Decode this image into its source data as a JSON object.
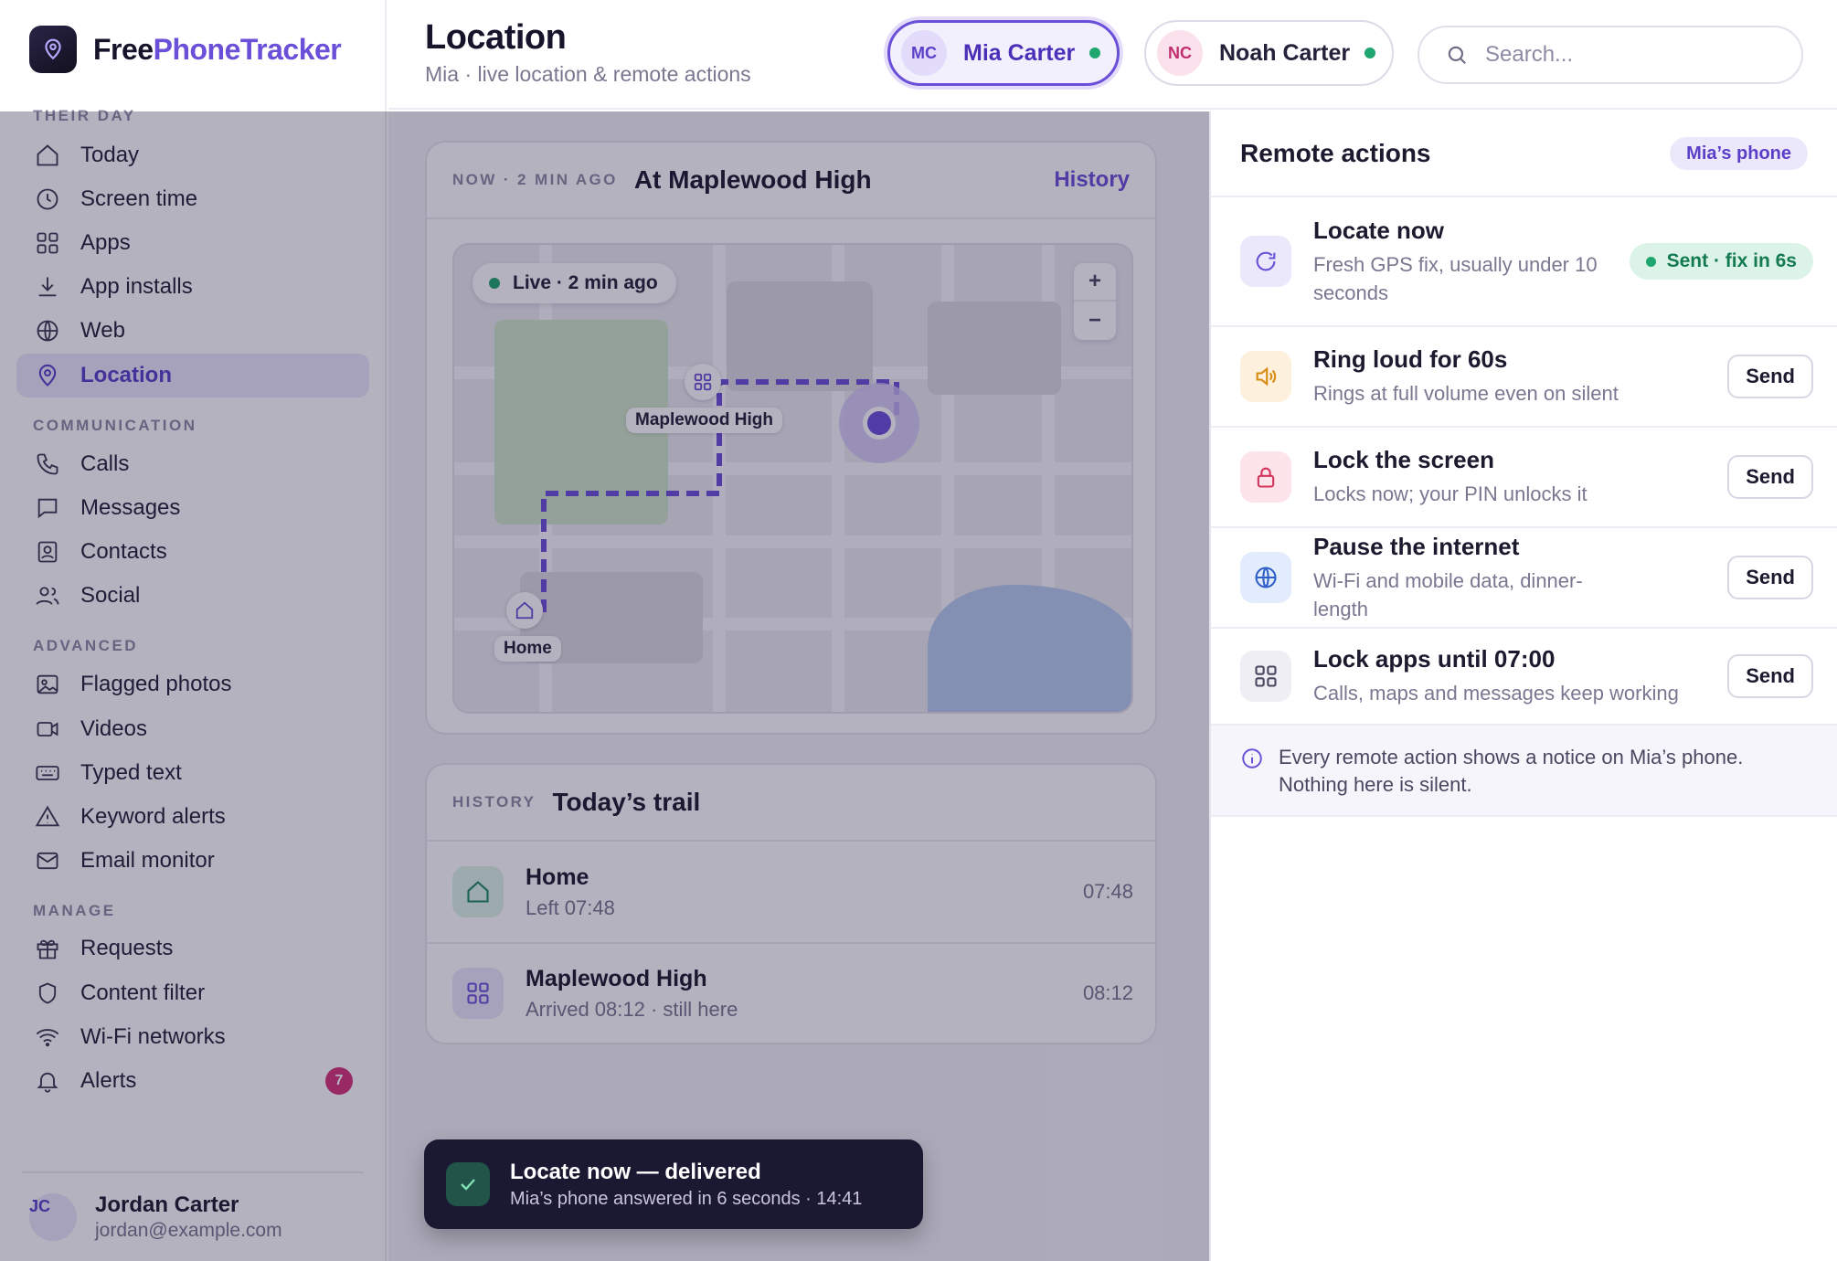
{
  "brand": {
    "free": "Free",
    "rest": "PhoneTracker"
  },
  "sidebar": {
    "sections": [
      {
        "title": "THEIR DAY",
        "items": [
          {
            "label": "Today",
            "icon": "home-icon"
          },
          {
            "label": "Screen time",
            "icon": "clock-icon"
          },
          {
            "label": "Apps",
            "icon": "grid-icon"
          },
          {
            "label": "App installs",
            "icon": "download-icon"
          },
          {
            "label": "Web",
            "icon": "globe-icon"
          },
          {
            "label": "Location",
            "icon": "map-pin-icon",
            "active": true
          }
        ]
      },
      {
        "title": "COMMUNICATION",
        "items": [
          {
            "label": "Calls",
            "icon": "phone-icon"
          },
          {
            "label": "Messages",
            "icon": "message-icon"
          },
          {
            "label": "Contacts",
            "icon": "contact-icon"
          },
          {
            "label": "Social",
            "icon": "users-icon"
          }
        ]
      },
      {
        "title": "ADVANCED",
        "items": [
          {
            "label": "Flagged photos",
            "icon": "image-icon"
          },
          {
            "label": "Videos",
            "icon": "video-icon"
          },
          {
            "label": "Typed text",
            "icon": "keyboard-icon"
          },
          {
            "label": "Keyword alerts",
            "icon": "warning-icon"
          },
          {
            "label": "Email monitor",
            "icon": "mail-icon"
          }
        ]
      },
      {
        "title": "MANAGE",
        "items": [
          {
            "label": "Requests",
            "icon": "gift-icon"
          },
          {
            "label": "Content filter",
            "icon": "shield-icon"
          },
          {
            "label": "Wi-Fi networks",
            "icon": "wifi-icon"
          },
          {
            "label": "Alerts",
            "icon": "bell-icon",
            "badge": "7"
          }
        ]
      }
    ],
    "user": {
      "initials": "JC",
      "name": "Jordan Carter",
      "email": "jordan@example.com"
    }
  },
  "header": {
    "title": "Location",
    "subtitle": "Mia · live location & remote actions",
    "children": [
      {
        "initials": "MC",
        "name": "Mia Carter",
        "selected": true
      },
      {
        "initials": "NC",
        "name": "Noah Carter",
        "selected": false
      }
    ],
    "search_placeholder": "Search..."
  },
  "location_card": {
    "kicker": "NOW · 2 MIN AGO",
    "title": "At Maplewood High",
    "link": "History",
    "live_pill": "Live · 2 min ago",
    "zoom_in": "+",
    "zoom_out": "−",
    "school_label": "Maplewood High",
    "home_label": "Home"
  },
  "trail_card": {
    "kicker": "HISTORY",
    "title": "Today’s trail",
    "rows": [
      {
        "name": "Home",
        "sub": "Left 07:48",
        "time": "07:48",
        "icon": "home-icon"
      },
      {
        "name": "Maplewood High",
        "sub": "Arrived 08:12 · still here",
        "time": "08:12",
        "icon": "grid-icon"
      }
    ]
  },
  "toast": {
    "title": "Locate now — delivered",
    "sub": "Mia’s phone answered in 6 seconds · 14:41"
  },
  "panel": {
    "title": "Remote actions",
    "badge": "Mia’s phone",
    "actions": [
      {
        "title": "Locate now",
        "sub": "Fresh GPS fix, usually under 10 seconds",
        "status": "Sent · fix in 6s",
        "icon": "refresh-icon"
      },
      {
        "title": "Ring loud for 60s",
        "sub": "Rings at full volume even on silent",
        "button": "Send",
        "icon": "speaker-icon"
      },
      {
        "title": "Lock the screen",
        "sub": "Locks now; your PIN unlocks it",
        "button": "Send",
        "icon": "lock-icon"
      },
      {
        "title": "Pause the internet",
        "sub": "Wi-Fi and mobile data, dinner-length",
        "button": "Send",
        "icon": "globe-icon"
      },
      {
        "title": "Lock apps until 07:00",
        "sub": "Calls, maps and messages keep working",
        "button": "Send",
        "icon": "grid-icon"
      }
    ],
    "notice": "Every remote action shows a notice on Mia’s phone. Nothing here is silent."
  },
  "colors": {
    "accent": "#6a4fd8",
    "online": "#1fa66e",
    "alert_badge": "#d6337a",
    "toast_bg": "#1b1832"
  }
}
